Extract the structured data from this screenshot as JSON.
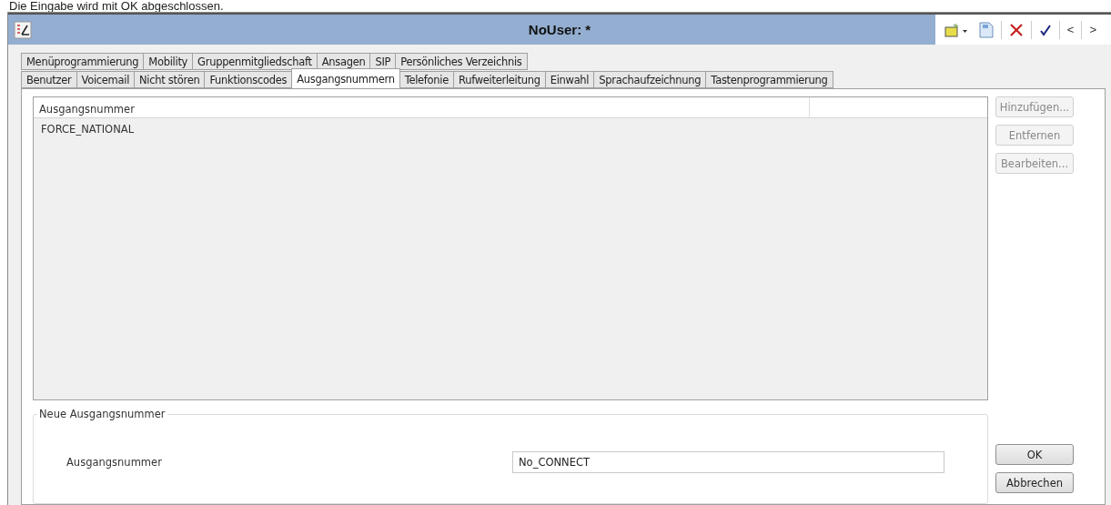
{
  "caption": "Die Eingabe wird mit OK abgeschlossen.",
  "window": {
    "title": "NoUser: *"
  },
  "toolbar": {
    "nav": [
      "<",
      ">"
    ]
  },
  "tab_rows": [
    {
      "tabs": [
        {
          "label": "Menüprogrammierung",
          "selected": false
        },
        {
          "label": "Mobility",
          "selected": false
        },
        {
          "label": "Gruppenmitgliedschaft",
          "selected": false
        },
        {
          "label": "Ansagen",
          "selected": false
        },
        {
          "label": "SIP",
          "selected": false
        },
        {
          "label": "Persönliches Verzeichnis",
          "selected": false
        }
      ]
    },
    {
      "tabs": [
        {
          "label": "Benutzer",
          "selected": false
        },
        {
          "label": "Voicemail",
          "selected": false
        },
        {
          "label": "Nicht stören",
          "selected": false
        },
        {
          "label": "Funktionscodes",
          "selected": false
        },
        {
          "label": "Ausgangsnummern",
          "selected": true
        },
        {
          "label": "Telefonie",
          "selected": false
        },
        {
          "label": "Rufweiterleitung",
          "selected": false
        },
        {
          "label": "Einwahl",
          "selected": false
        },
        {
          "label": "Sprachaufzeichnung",
          "selected": false
        },
        {
          "label": "Tastenprogrammierung",
          "selected": false
        }
      ]
    }
  ],
  "list": {
    "column": "Ausgangsnummer",
    "rows": [
      "FORCE_NATIONAL"
    ]
  },
  "side_buttons": [
    {
      "label": "Hinzufügen...",
      "disabled": true
    },
    {
      "label": "Entfernen",
      "disabled": true
    },
    {
      "label": "Bearbeiten...",
      "disabled": true
    }
  ],
  "group": {
    "title": "Neue Ausgangsnummer",
    "label": "Ausgangsnummer",
    "value": "No_CONNECT"
  },
  "buttons": [
    {
      "label": "OK",
      "disabled": false
    },
    {
      "label": "Abbrechen",
      "disabled": false
    }
  ]
}
